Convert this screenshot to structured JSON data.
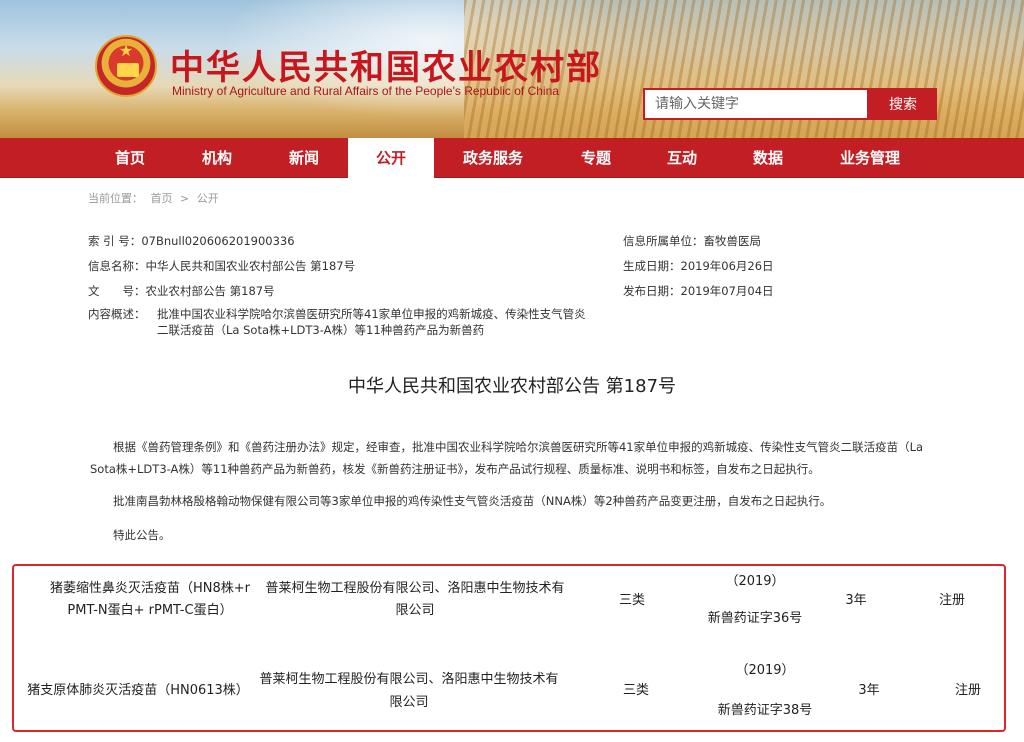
{
  "header": {
    "title": "中华人民共和国农业农村部",
    "subtitle": "Ministry of Agriculture and Rural Affairs of the People's Republic of China",
    "search_placeholder": "请输入关键字",
    "search_button": "搜索"
  },
  "nav": {
    "items": [
      {
        "label": "首页"
      },
      {
        "label": "机构"
      },
      {
        "label": "新闻"
      },
      {
        "label": "公开"
      },
      {
        "label": "政务服务"
      },
      {
        "label": "专题"
      },
      {
        "label": "互动"
      },
      {
        "label": "数据"
      },
      {
        "label": "业务管理"
      }
    ],
    "active": "公开"
  },
  "breadcrumb": {
    "prefix": "当前位置：",
    "home": "首页",
    "sep": ">",
    "current": "公开"
  },
  "meta": {
    "index_label": "索 引 号：",
    "index_value": "07Bnull020606201900336",
    "name_label": "信息名称：",
    "name_value": "中华人民共和国农业农村部公告 第187号",
    "doc_label": "文　　号：",
    "doc_value": "农业农村部公告 第187号",
    "summary_label": "内容概述：",
    "summary_value": "批准中国农业科学院哈尔滨兽医研究所等41家单位申报的鸡新城疫、传染性支气管炎二联活疫苗（La Sota株+LDT3-A株）等11种兽药产品为新兽药",
    "unit_label": "信息所属单位：",
    "unit_value": "畜牧兽医局",
    "created_label": "生成日期：",
    "created_value": "2019年06月26日",
    "published_label": "发布日期：",
    "published_value": "2019年07月04日"
  },
  "article": {
    "title": "中华人民共和国农业农村部公告 第187号",
    "p1": "根据《兽药管理条例》和《兽药注册办法》规定，经审查，批准中国农业科学院哈尔滨兽医研究所等41家单位申报的鸡新城疫、传染性支气管炎二联活疫苗（La Sota株+LDT3-A株）等11种兽药产品为新兽药，核发《新兽药注册证书》，发布产品试行规程、质量标准、说明书和标签，自发布之日起执行。",
    "p2": "批准南昌勃林格殷格翰动物保健有限公司等3家单位申报的鸡传染性支气管炎活疫苗（NNA株）等2种兽药产品变更注册，自发布之日起执行。",
    "p3": "特此公告。"
  },
  "table": {
    "rows": [
      {
        "name_line1": "猪萎缩性鼻炎灭活疫苗（HN8株+r",
        "name_line2": "PMT-N蛋白+ rPMT-C蛋白）",
        "company_line1": "普莱柯生物工程股份有限公司、洛阳惠中生物技术有",
        "company_line2": "限公司",
        "category": "三类",
        "cert_line1": "（2019）",
        "cert_line2": "新兽药证字36号",
        "period": "3年",
        "type": "注册"
      },
      {
        "name_line1": "猪支原体肺炎灭活疫苗（HN0613株）",
        "name_line2": "",
        "company_line1": "普莱柯生物工程股份有限公司、洛阳惠中生物技术有",
        "company_line2": "限公司",
        "category": "三类",
        "cert_line1": "（2019）",
        "cert_line2": "新兽药证字38号",
        "period": "3年",
        "type": "注册"
      }
    ]
  }
}
